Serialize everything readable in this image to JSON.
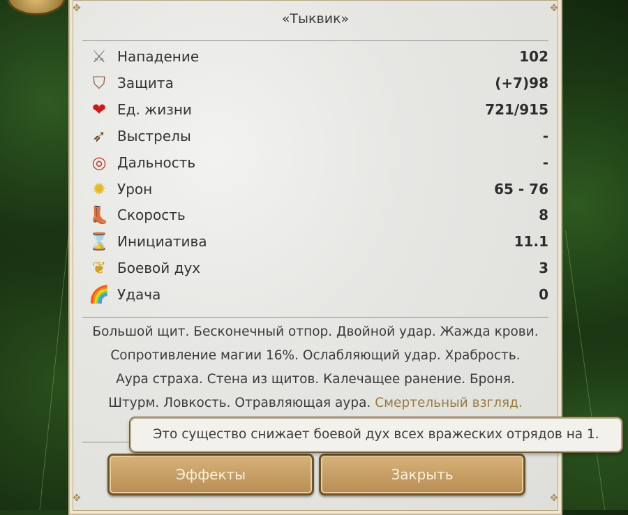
{
  "title": "«Тыквик»",
  "stats": [
    {
      "icon": "attack-swords-icon",
      "glyph": "⚔",
      "color": "#7a7a7a",
      "label": "Нападение",
      "value": "102"
    },
    {
      "icon": "defense-shield-icon",
      "glyph": "⛉",
      "color": "#8a5a3a",
      "label": "Защита",
      "value": "(+7)98"
    },
    {
      "icon": "heart-icon",
      "glyph": "❤",
      "color": "#d31717",
      "label": "Ед. жизни",
      "value": "721/915"
    },
    {
      "icon": "arrow-shots-icon",
      "glyph": "➶",
      "color": "#6a4a2a",
      "label": "Выстрелы",
      "value": "-"
    },
    {
      "icon": "target-range-icon",
      "glyph": "◎",
      "color": "#c0392b",
      "label": "Дальность",
      "value": "-"
    },
    {
      "icon": "damage-burst-icon",
      "glyph": "✹",
      "color": "#e8b923",
      "label": "Урон",
      "value": "65 - 76"
    },
    {
      "icon": "boot-speed-icon",
      "glyph": "👢",
      "color": "#8a4a2a",
      "label": "Скорость",
      "value": "8"
    },
    {
      "icon": "hourglass-initiative-icon",
      "glyph": "⌛",
      "color": "#8a6a3a",
      "label": "Инициатива",
      "value": "11.1"
    },
    {
      "icon": "winged-morale-icon",
      "glyph": "❦",
      "color": "#d4a017",
      "label": "Боевой дух",
      "value": "3"
    },
    {
      "icon": "rainbow-luck-icon",
      "glyph": "🌈",
      "color": "#e07020",
      "label": "Удача",
      "value": "0"
    }
  ],
  "abilities": {
    "line1": "Большой щит. Бесконечный отпор. Двойной удар. Жажда крови.",
    "line2": "Сопротивление магии 16%. Ослабляющий удар. Храбрость.",
    "line3": "Аура страха. Стена из щитов. Калечащее ранение. Броня.",
    "line4_prefix": "Штурм. Ловкость. Отравляющая аура.",
    "line4_highlight": "Смертельный взгляд."
  },
  "tooltip": "Это существо снижает боевой дух всех вражеских отрядов на 1.",
  "buttons": {
    "effects": "Эффекты",
    "close": "Закрыть"
  },
  "colors": {
    "highlight": "#9a7a3e",
    "button": "#c9a062"
  }
}
